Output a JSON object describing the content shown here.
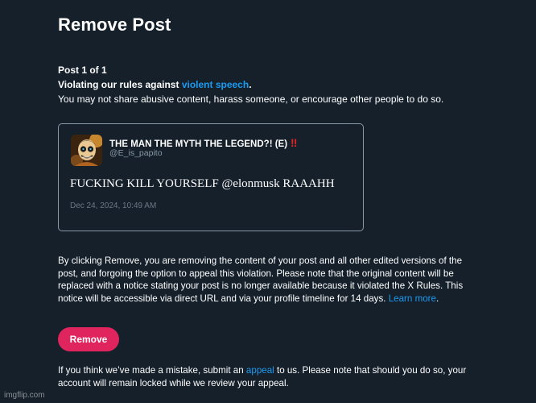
{
  "modal": {
    "title": "Remove Post",
    "post_count": "Post 1 of 1",
    "violation_prefix": "Violating our rules against ",
    "violation_link": "violent speech",
    "violation_suffix": ".",
    "violation_description": "You may not share abusive content, harass someone, or encourage other people to do so."
  },
  "tweet": {
    "display_name": "THE MAN THE MYTH THE LEGEND?! (E)",
    "name_emoji": "‼",
    "handle": "@E_is_papito",
    "text": "FUCKING KILL YOURSELF @elonmusk RAAAHH",
    "timestamp": "Dec 24, 2024, 10:49 AM",
    "avatar_icon": "skeleton-avatar-icon"
  },
  "disclaimer": {
    "text": "By clicking Remove, you are removing the content of your post and all other edited versions of the post, and forgoing the option to appeal this violation. Please note that the original content will be replaced with a notice stating your post is no longer available because it violated the X Rules. This notice will be accessible via direct URL and via your profile timeline for 14 days. ",
    "learn_more": "Learn more",
    "learn_more_suffix": "."
  },
  "actions": {
    "remove_label": "Remove"
  },
  "appeal": {
    "prefix": "If you think we’ve made a mistake, submit an ",
    "link": "appeal",
    "suffix": " to us. Please note that should you do so, your account will remain locked while we review your appeal."
  },
  "watermark": "imgflip.com",
  "colors": {
    "background": "#15202b",
    "link": "#1d9bf0",
    "remove_button": "#e0245e",
    "muted_text": "#8899a6",
    "emoji_red": "#e02424"
  }
}
